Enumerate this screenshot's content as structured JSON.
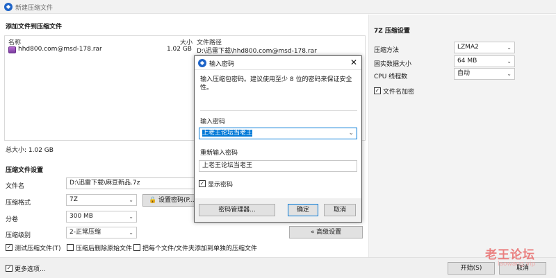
{
  "window": {
    "title": "新建压缩文件"
  },
  "files": {
    "section_title": "添加文件到压缩文件",
    "columns": {
      "name": "名称",
      "size": "大小",
      "path": "文件路径"
    },
    "rows": [
      {
        "name": "hhd800.com@msd-178.rar",
        "size": "1.02 GB",
        "path": "D:\\迅雷下载\\hhd800.com@msd-178.rar"
      }
    ],
    "total": "总大小: 1.02 GB"
  },
  "settings": {
    "section_title": "压缩文件设置",
    "filename_label": "文件名",
    "filename_value": "D:\\迅雷下载\\麻豆新品.7z",
    "format_label": "压缩格式",
    "format_value": "7Z",
    "split_label": "分卷",
    "split_value": "300 MB",
    "level_label": "压缩级别",
    "level_value": "2-正常压缩",
    "set_password_label": "设置密码(P...",
    "advanced_label": "« 高级设置",
    "test_label": "测试压缩文件(T)",
    "test_checked": true,
    "delete_label": "压缩后删除原始文件",
    "delete_checked": false,
    "separate_label": "把每个文件/文件夹添加到单独的压缩文件",
    "separate_checked": false
  },
  "right_panel": {
    "title": "7Z 压缩设置",
    "method_label": "压缩方法",
    "method_value": "LZMA2",
    "dict_label": "固实数据大小",
    "dict_value": "64 MB",
    "threads_label": "CPU 线程数",
    "threads_value": "自动",
    "encrypt_names_label": "文件名加密",
    "encrypt_names_checked": true
  },
  "bottom": {
    "more_options": "更多选项...",
    "more_checked": true,
    "start": "开始(S)",
    "cancel": "取消"
  },
  "dialog": {
    "title": "输入密码",
    "hint": "输入压缩包密码。建议使用至少 8 位的密码来保证安全性。",
    "pw_label": "输入密码",
    "pw_value": "上老王论坛当老王",
    "pw2_label": "重新输入密码",
    "pw2_value": "上老王论坛当老王",
    "show_label": "显示密码",
    "show_checked": true,
    "manager": "密码管理器...",
    "ok": "确定",
    "cancel": "取消"
  },
  "watermark": {
    "text": "老王论坛",
    "sub": "laowang.vip"
  },
  "colors": {
    "accent": "#0078d7",
    "app_icon": "#1e64c8",
    "watermark": "#e85a5a"
  }
}
